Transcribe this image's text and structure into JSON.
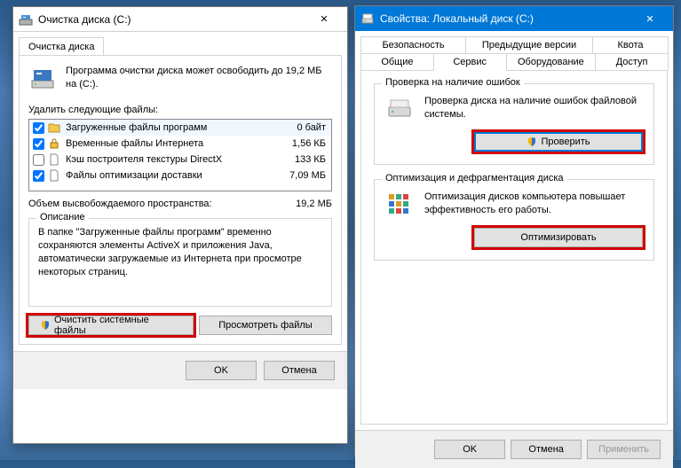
{
  "cleanup": {
    "title": "Очистка диска (C:)",
    "tab_label": "Очистка диска",
    "summary": "Программа очистки диска может освободить до 19,2 МБ на (C:).",
    "delete_label": "Удалить следующие файлы:",
    "files": [
      {
        "checked": true,
        "icon": "folder-icon",
        "name": "Загруженные файлы программ",
        "size": "0 байт"
      },
      {
        "checked": true,
        "icon": "lock-icon",
        "name": "Временные файлы Интернета",
        "size": "1,56 КБ"
      },
      {
        "checked": false,
        "icon": "file-icon",
        "name": "Кэш построителя текстуры DirectX",
        "size": "133 КБ"
      },
      {
        "checked": true,
        "icon": "file-icon",
        "name": "Файлы оптимизации доставки",
        "size": "7,09 МБ"
      }
    ],
    "total_label": "Объем высвобождаемого пространства:",
    "total_value": "19,2 МБ",
    "desc_legend": "Описание",
    "desc_text": "В папке \"Загруженные файлы программ\" временно сохраняются элементы ActiveX и приложения Java, автоматически загружаемые из Интернета при просмотре некоторых страниц.",
    "btn_clean_system": "Очистить системные файлы",
    "btn_view_files": "Просмотреть файлы",
    "btn_ok": "OK",
    "btn_cancel": "Отмена"
  },
  "props": {
    "title": "Свойства: Локальный диск (C:)",
    "tabs_row1": [
      "Безопасность",
      "Предыдущие версии",
      "Квота"
    ],
    "tabs_row2": [
      "Общие",
      "Сервис",
      "Оборудование",
      "Доступ"
    ],
    "active_tab": "Сервис",
    "errcheck": {
      "legend": "Проверка на наличие ошибок",
      "text": "Проверка диска на наличие ошибок файловой системы.",
      "btn": "Проверить"
    },
    "defrag": {
      "legend": "Оптимизация и дефрагментация диска",
      "text": "Оптимизация дисков компьютера повышает эффективность его работы.",
      "btn": "Оптимизировать"
    },
    "btn_ok": "OK",
    "btn_cancel": "Отмена",
    "btn_apply": "Применить"
  }
}
